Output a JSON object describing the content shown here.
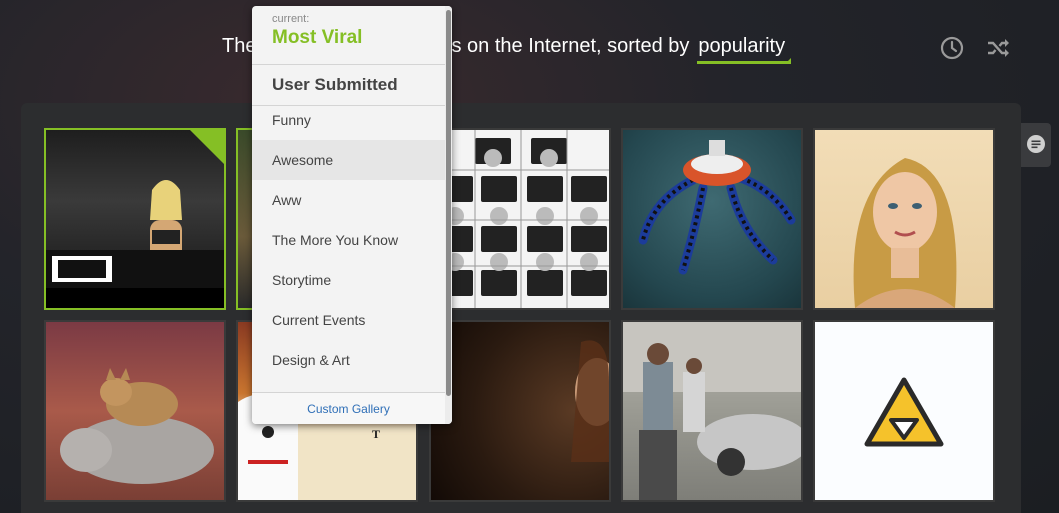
{
  "header": {
    "headline_prefix": "The",
    "headline_middle": "s on the Internet, sorted by",
    "sort_value": "popularity",
    "history_icon": "clock-icon",
    "random_icon": "shuffle-icon"
  },
  "side_tab": {
    "icon": "comment-icon"
  },
  "dropdown": {
    "current_label": "current:",
    "current_value": "Most Viral",
    "user_submitted": "User Submitted",
    "items": [
      {
        "label": "Funny"
      },
      {
        "label": "Awesome"
      },
      {
        "label": "Aww"
      },
      {
        "label": "The More You Know"
      },
      {
        "label": "Storytime"
      },
      {
        "label": "Current Events"
      },
      {
        "label": "Design & Art"
      }
    ],
    "footer": "Custom Gallery"
  },
  "gallery": {
    "thumbs": [
      {
        "image": "vice-photo"
      },
      {
        "image": "partial-photo-green"
      },
      {
        "image": "kids-chalkboard-grid"
      },
      {
        "image": "robot-spider"
      },
      {
        "image": "blonde-portrait"
      },
      {
        "image": "cat-on-dog"
      },
      {
        "image": "cartoon-meant-to"
      },
      {
        "image": "girl-dark-scene"
      },
      {
        "image": "men-by-car"
      },
      {
        "image": "warning-triangle-icon"
      }
    ],
    "cartoon_caption": "MEANT T"
  },
  "colors": {
    "accent": "#85bf25",
    "panel": "#2c2d2f",
    "link": "#2f6fb7"
  }
}
